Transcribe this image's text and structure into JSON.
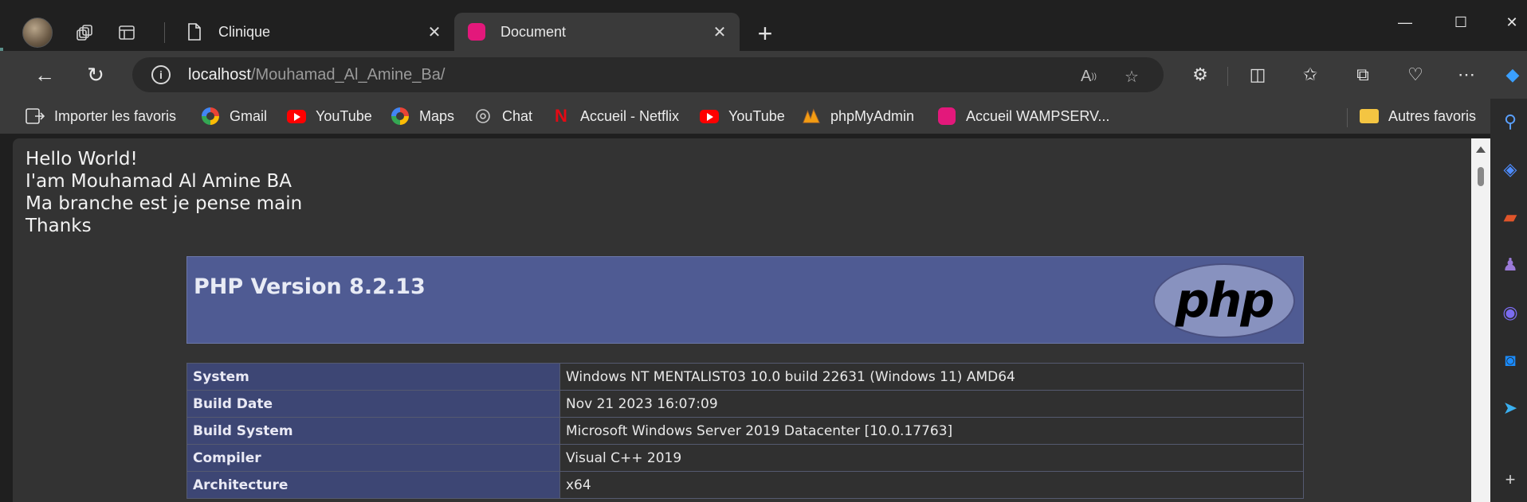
{
  "tabs": [
    {
      "title": "Clinique",
      "icon": "page-icon"
    },
    {
      "title": "Document",
      "icon": "wamp-icon"
    }
  ],
  "address": {
    "host": "localhost",
    "path": "/Mouhamad_Al_Amine_Ba/"
  },
  "favorites": [
    {
      "label": "Importer les favoris",
      "icon": "import-icon"
    },
    {
      "label": "Gmail",
      "icon": "google-icon"
    },
    {
      "label": "YouTube",
      "icon": "youtube-icon"
    },
    {
      "label": "Maps",
      "icon": "google-icon"
    },
    {
      "label": "Chat",
      "icon": "chatgpt-icon"
    },
    {
      "label": "Accueil - Netflix",
      "icon": "netflix-icon"
    },
    {
      "label": "YouTube",
      "icon": "youtube-icon"
    },
    {
      "label": "phpMyAdmin",
      "icon": "phpmyadmin-icon"
    },
    {
      "label": "Accueil WAMPSERV...",
      "icon": "wamp-icon"
    }
  ],
  "other_favorites": "Autres favoris",
  "page": {
    "lines": [
      "Hello World!",
      "I'am Mouhamad Al Amine BA",
      "Ma branche est je pense main",
      "Thanks"
    ],
    "php_version": "PHP Version 8.2.13",
    "php_logo_text": "php",
    "info_rows": [
      {
        "key": "System",
        "value": "Windows NT MENTALIST03 10.0 build 22631 (Windows 11) AMD64"
      },
      {
        "key": "Build Date",
        "value": "Nov 21 2023 16:07:09"
      },
      {
        "key": "Build System",
        "value": "Microsoft Windows Server 2019 Datacenter [10.0.17763]"
      },
      {
        "key": "Compiler",
        "value": "Visual C++ 2019"
      },
      {
        "key": "Architecture",
        "value": "x64"
      }
    ]
  },
  "colors": {
    "php_header": "#4f5b93",
    "php_key_cell": "#3d4674",
    "wamp": "#e3187b"
  }
}
